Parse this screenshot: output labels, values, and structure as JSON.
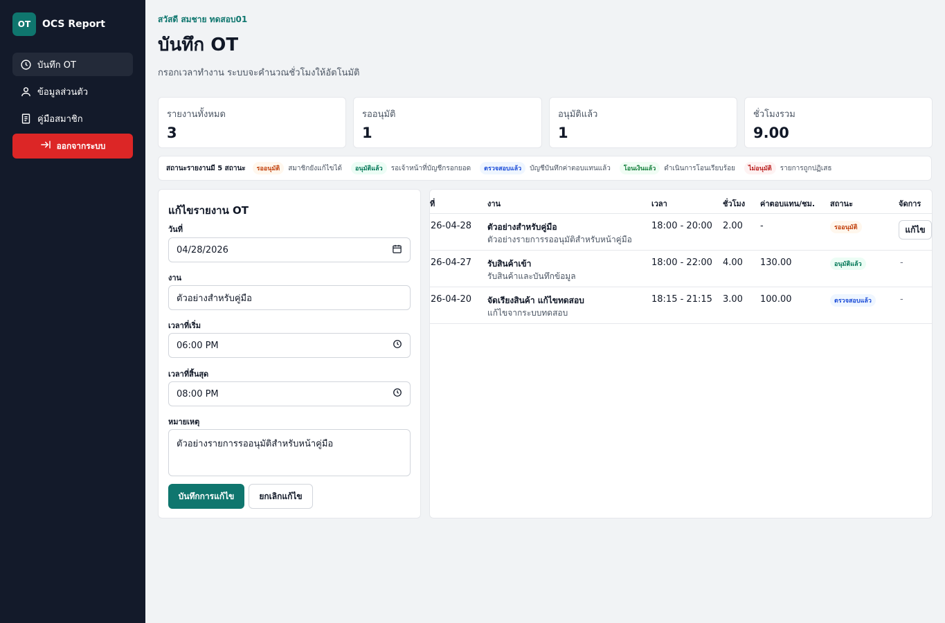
{
  "brand": {
    "logo": "OT",
    "name": "OCS Report"
  },
  "nav": [
    {
      "label": "บันทึก OT",
      "icon": "clock-icon",
      "active": true
    },
    {
      "label": "ข้อมูลส่วนตัว",
      "icon": "user-icon",
      "active": false
    },
    {
      "label": "คู่มือสมาชิก",
      "icon": "book-icon",
      "active": false
    }
  ],
  "logout": {
    "label": "ออกจากระบบ",
    "icon": "logout-arrow-icon"
  },
  "header": {
    "greeting": "สวัสดี สมชาย ทดสอบ01",
    "title": "บันทึก OT",
    "subtitle": "กรอกเวลาทำงาน ระบบจะคำนวณชั่วโมงให้อัตโนมัติ"
  },
  "stats": [
    {
      "label": "รายงานทั้งหมด",
      "value": "3"
    },
    {
      "label": "รออนุมัติ",
      "value": "1"
    },
    {
      "label": "อนุมัติแล้ว",
      "value": "1"
    },
    {
      "label": "ชั่วโมงรวม",
      "value": "9.00"
    }
  ],
  "legend": {
    "intro": "สถานะรายงานมี 5 สถานะ",
    "items": [
      {
        "badge": "รออนุมัติ",
        "desc": "สมาชิกยังแก้ไขได้",
        "color": "#c2410c"
      },
      {
        "badge": "อนุมัติแล้ว",
        "desc": "รอเจ้าหน้าที่บัญชีกรอกยอด",
        "color": "#047857"
      },
      {
        "badge": "ตรวจสอบแล้ว",
        "desc": "บัญชีบันทึกค่าตอบแทนแล้ว",
        "color": "#1d4ed8"
      },
      {
        "badge": "โอนเงินแล้ว",
        "desc": "ดำเนินการโอนเรียบร้อย",
        "color": "#15803d"
      },
      {
        "badge": "ไม่อนุมัติ",
        "desc": "รายการถูกปฏิเสธ",
        "color": "#b91c1c"
      }
    ]
  },
  "form": {
    "title": "แก้ไขรายงาน OT",
    "date_label": "วันที่",
    "date_value": "04/28/2026",
    "task_label": "งาน",
    "task_value": "ตัวอย่างสำหรับคู่มือ",
    "start_label": "เวลาที่เริ่ม",
    "start_value": "06:00 PM",
    "end_label": "เวลาที่สิ้นสุด",
    "end_value": "08:00 PM",
    "note_label": "หมายเหตุ",
    "note_value": "ตัวอย่างรายการรออนุมัติสำหรับหน้าคู่มือ",
    "save_label": "บันทึกการแก้ไข",
    "cancel_label": "ยกเลิกแก้ไข"
  },
  "table": {
    "headers": [
      "ที่",
      "งาน",
      "เวลา",
      "ชั่วโมง",
      "ค่าตอบแทน/ชม.",
      "สถานะ",
      "จัดการ"
    ],
    "rows": [
      {
        "date": "26-04-28",
        "task": "ตัวอย่างสำหรับคู่มือ",
        "note": "ตัวอย่างรายการรออนุมัติสำหรับหน้าคู่มือ",
        "time": "18:00 - 20:00",
        "hours": "2.00",
        "rate": "-",
        "status": "รออนุมัติ",
        "action": "แก้ไข"
      },
      {
        "date": "26-04-27",
        "task": "รับสินค้าเข้า",
        "note": "รับสินค้าและบันทึกข้อมูล",
        "time": "18:00 - 22:00",
        "hours": "4.00",
        "rate": "130.00",
        "status": "อนุมัติแล้ว",
        "action": "-"
      },
      {
        "date": "26-04-20",
        "task": "จัดเรียงสินค้า แก้ไขทดสอบ",
        "note": "แก้ไขจากระบบทดสอบ",
        "time": "18:15 - 21:15",
        "hours": "3.00",
        "rate": "100.00",
        "status": "ตรวจสอบแล้ว",
        "action": "-"
      }
    ]
  }
}
